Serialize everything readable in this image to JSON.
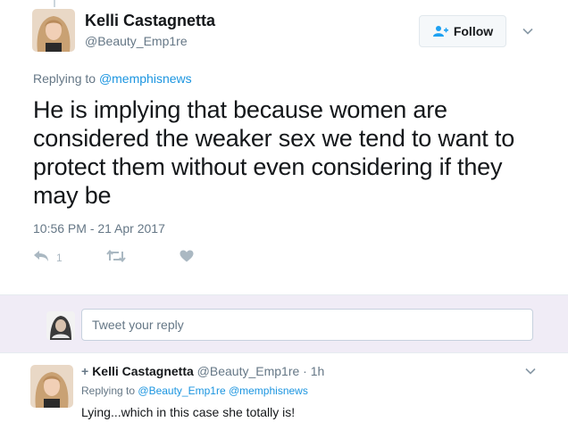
{
  "main_tweet": {
    "author_name": "Kelli Castagnetta",
    "author_handle": "@Beauty_Emp1re",
    "follow_label": "Follow",
    "replying_prefix": "Replying to",
    "replying_handle": "@memphisnews",
    "text": "He is implying that because women are considered the weaker sex we tend to want to protect them without even considering if they may be",
    "timestamp": "10:56 PM - 21 Apr 2017",
    "reply_count": "1"
  },
  "composer": {
    "placeholder": "Tweet your reply"
  },
  "reply_tweet": {
    "plus": "+",
    "author_name": "Kelli Castagnetta",
    "meta": "@Beauty_Emp1re · 1h",
    "replying_prefix": "Replying to",
    "replying_handles": "@Beauty_Emp1re @memphisnews",
    "text": "Lying...which in this case she totally is!"
  },
  "icons": {
    "follow": "person-add-icon",
    "more": "chevron-down-icon",
    "reply": "reply-icon",
    "retweet": "retweet-icon",
    "like": "heart-icon"
  },
  "colors": {
    "link": "#1b95e0",
    "secondary_text": "#657786",
    "action_icon": "#aab8c2",
    "composer_bg": "#f0ecf6"
  }
}
